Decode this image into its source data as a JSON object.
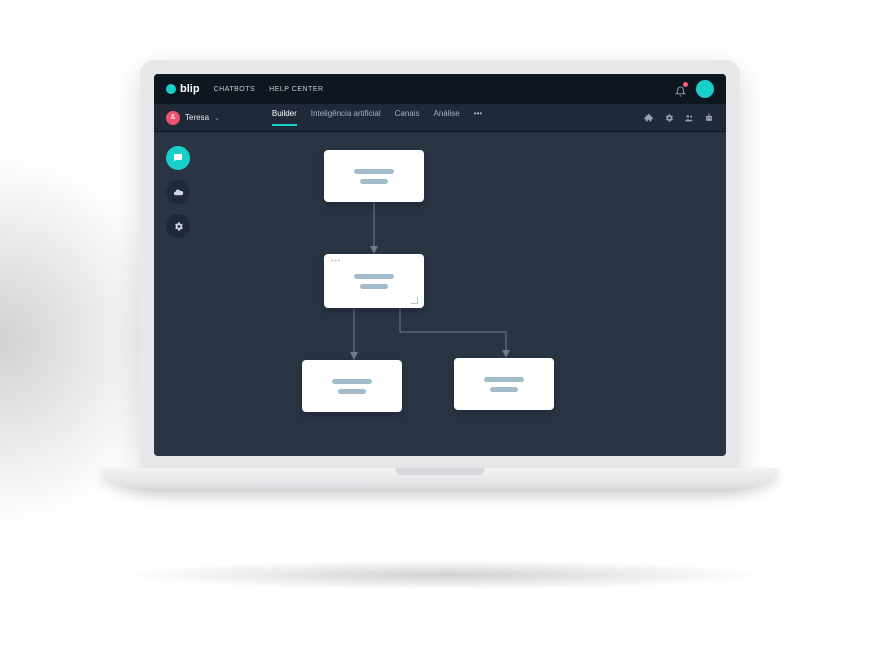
{
  "brand": {
    "name": "blip"
  },
  "topnav": {
    "links": [
      "CHATBOTS",
      "HELP CENTER"
    ]
  },
  "user": {
    "name": "Teresa"
  },
  "tabs": [
    {
      "label": "Builder",
      "active": true
    },
    {
      "label": "Inteligência artificial",
      "active": false
    },
    {
      "label": "Canais",
      "active": false
    },
    {
      "label": "Análise",
      "active": false
    },
    {
      "label": "•••",
      "active": false
    }
  ],
  "icons": {
    "chat": "chat-icon",
    "cloud": "cloud-icon",
    "gear": "gear-icon",
    "bell": "bell-icon",
    "avatar": "avatar",
    "puzzle": "puzzle-icon",
    "settings": "settings-icon",
    "team": "team-icon",
    "robot": "robot-icon"
  },
  "colors": {
    "accent": "#18d0c9",
    "canvas": "#2a3544",
    "panel": "#1f2937",
    "topbar": "#0e1620"
  }
}
